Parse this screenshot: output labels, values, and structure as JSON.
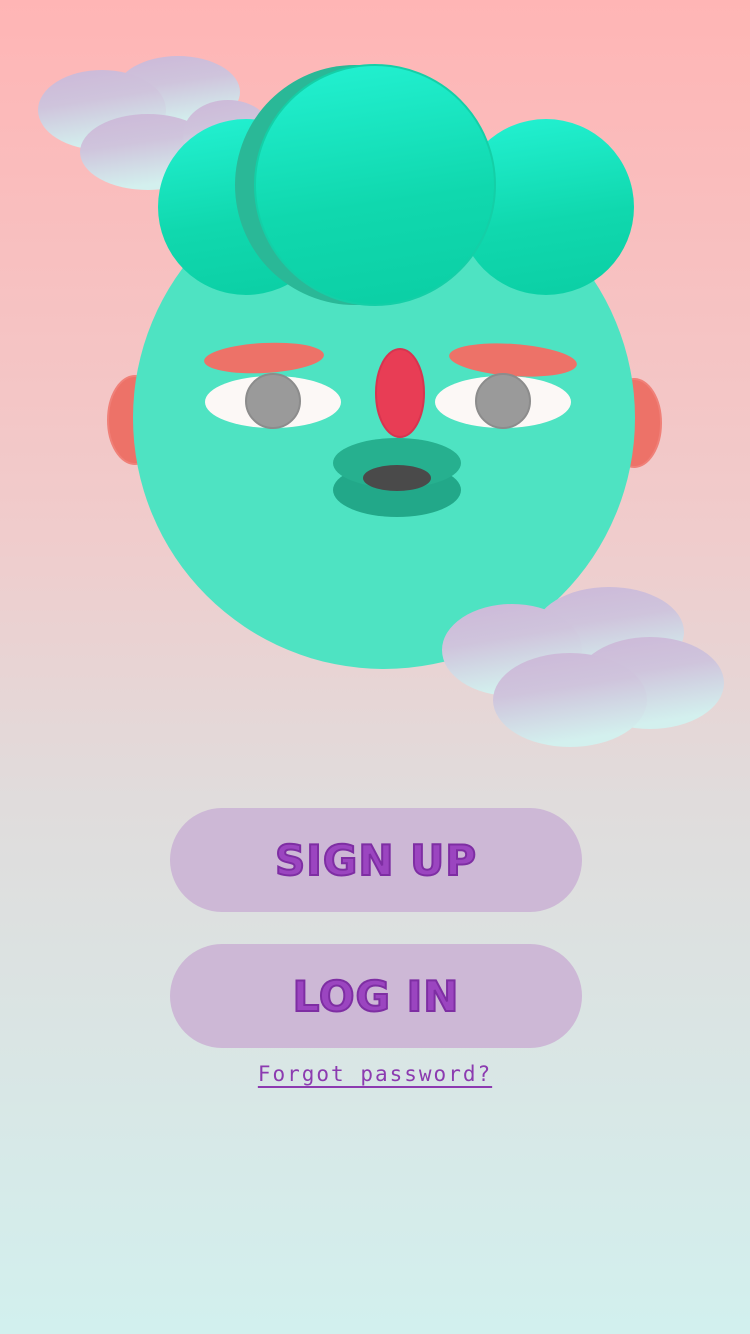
{
  "auth": {
    "signup_label": "SIGN UP",
    "login_label": "LOG IN",
    "forgot_label": "Forgot password?"
  },
  "icons": {
    "illustration": "cartoon-face-with-clouds-icon"
  },
  "colors": {
    "face": "#4ee3c2",
    "hair": "#12dbb0",
    "cheek": "#ed7268",
    "nose": "#e83d55",
    "mouth": "#22a889",
    "button_bg": "#cdb8d6",
    "button_text": "#9b45c0",
    "link": "#8c3bb0"
  }
}
